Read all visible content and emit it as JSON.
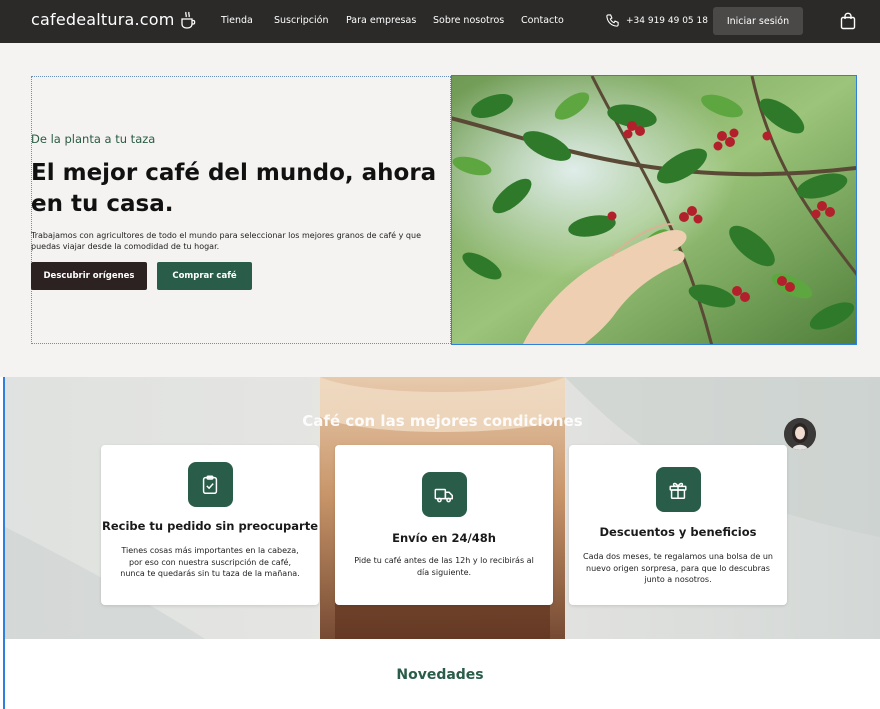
{
  "header": {
    "logo": "cafedealtura.com",
    "nav": [
      "Tienda",
      "Suscripción",
      "Para empresas",
      "Sobre nosotros",
      "Contacto"
    ],
    "phone": "+34 919 49 05 18",
    "login_label": "Iniciar sesión"
  },
  "hero": {
    "eyebrow": "De la planta a tu taza",
    "title": "El mejor café del mundo, ahora en tu casa.",
    "description": "Trabajamos con agricultores de todo el mundo para seleccionar los mejores granos de café y que puedas viajar desde la comodidad de tu hogar.",
    "primary_button": "Descubrir orígenes",
    "secondary_button": "Comprar café"
  },
  "conditions": {
    "title": "Café con las mejores condiciones",
    "cards": [
      {
        "icon": "clipboard-check-icon",
        "title": "Recibe tu pedido sin preocuparte",
        "text": "Tienes cosas más importantes en la cabeza, por eso con nuestra suscripción de café, nunca te quedarás sin tu taza de la mañana."
      },
      {
        "icon": "truck-icon",
        "title": "Envío en 24/48h",
        "text": "Pide tu café antes de las 12h y lo recibirás al día siguiente."
      },
      {
        "icon": "gift-icon",
        "title": "Descuentos y beneficios",
        "text": "Cada dos meses, te regalamos una bolsa de un nuevo origen sorpresa, para que lo descubras junto a nosotros."
      }
    ]
  },
  "news": {
    "title": "Novedades"
  },
  "colors": {
    "header_bg": "#2b2a29",
    "brand_green": "#2a5d49",
    "dark_button": "#2b2221",
    "hero_bg": "#f4f3f1"
  }
}
